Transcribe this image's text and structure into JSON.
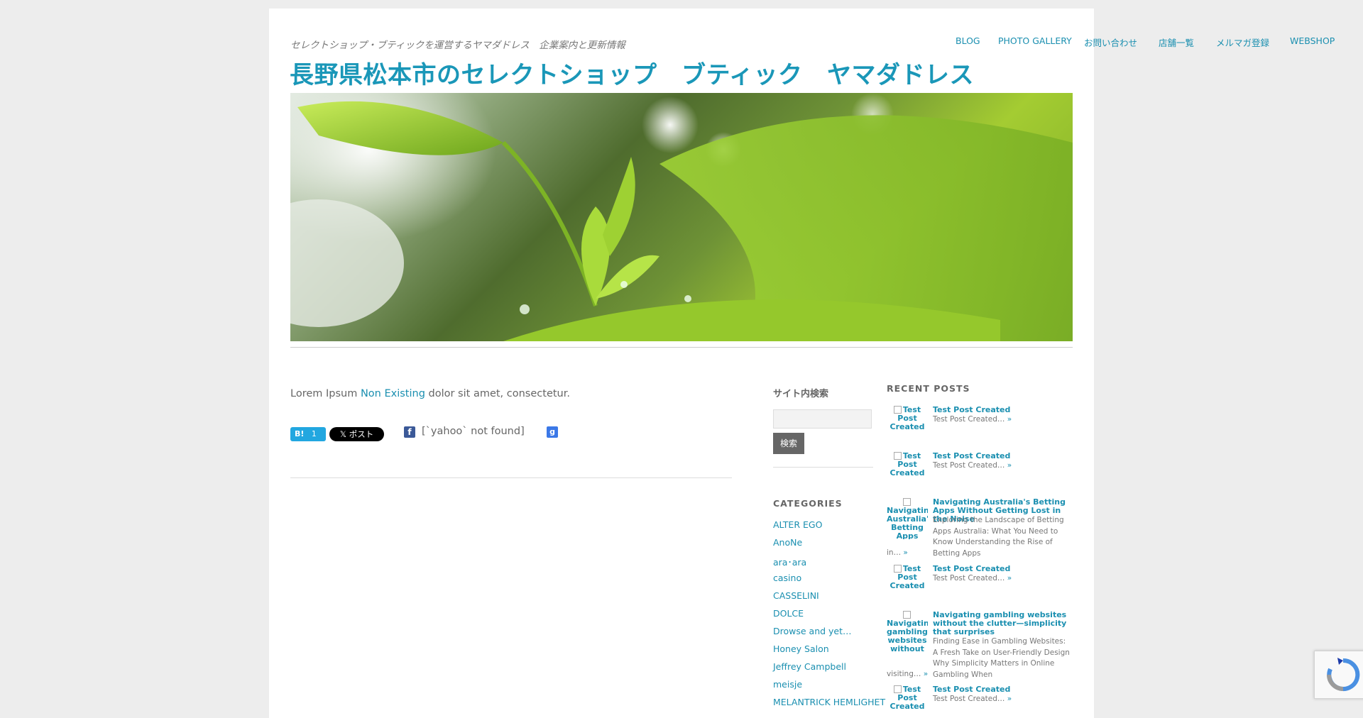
{
  "header": {
    "tagline": "セレクトショップ・ブティックを運営するヤマダドレス　企業案内と更新情報",
    "site_title": "長野県松本市のセレクトショップ　ブティック　ヤマダドレス",
    "nav": [
      "BLOG",
      "PHOTO GALLERY",
      "お問い合わせ",
      "店舗一覧",
      "メルマガ登録",
      "WEBSHOP"
    ]
  },
  "post": {
    "text_before": "Lorem Ipsum ",
    "link": "Non Existing",
    "text_after": " dolor sit amet, consectetur.",
    "share": {
      "hatena_label": "B!",
      "hatena_count": "1",
      "tweet_label": "𝕏 ポスト",
      "facebook_icon": "f",
      "yahoo_text": "[`yahoo` not found]",
      "google_icon": "g"
    }
  },
  "sidebar1": {
    "search_title": "サイト内検索",
    "search_button": "検索",
    "categories_title": "CATEGORIES",
    "categories": [
      "ALTER EGO",
      "AnoNe",
      "ara･ara",
      "casino",
      "CASSELINI",
      "DOLCE",
      "Drowse and yet…",
      "Honey Salon",
      "Jeffrey Campbell",
      "meisje",
      "MELANTRICK HEMLIGHET"
    ]
  },
  "sidebar2": {
    "recent_title": "RECENT POSTS",
    "posts": [
      {
        "thumb": "Test Post Created",
        "title": "Test Post Created",
        "excerpt": "Test Post Created…",
        "more": "»"
      },
      {
        "thumb": "Test Post Created",
        "title": "Test Post Created",
        "excerpt": "Test Post Created…",
        "more": "»"
      },
      {
        "thumb": "Navigating Australia's Betting Apps",
        "title": "Navigating Australia's Betting Apps Without Getting Lost in the Noise",
        "excerpt": "Exploring the Landscape of Betting Apps Australia: What You Need to Know Understanding the Rise of Betting Apps",
        "tail": "in…",
        "more": "»"
      },
      {
        "thumb": "Test Post Created",
        "title": "Test Post Created",
        "excerpt": "Test Post Created…",
        "more": "»"
      },
      {
        "thumb": "Navigating gambling websites without the",
        "title": "Navigating gambling websites without the clutter—simplicity that surprises",
        "excerpt": "Finding Ease in Gambling Websites: A Fresh Take on User-Friendly Design Why Simplicity Matters in Online Gambling When",
        "tail": "visiting…",
        "more": "»"
      },
      {
        "thumb": "Test Post Created",
        "title": "Test Post Created",
        "excerpt": "Test Post Created…",
        "more": "»"
      }
    ]
  }
}
